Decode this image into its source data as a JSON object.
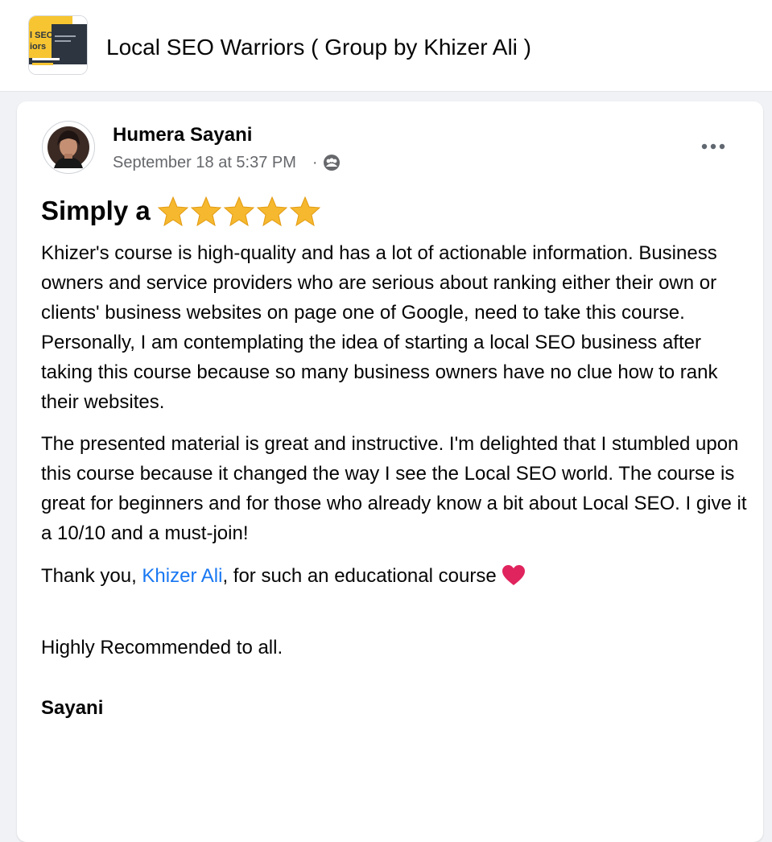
{
  "group": {
    "title": "Local SEO Warriors ( Group by Khizer Ali )",
    "logo_text_line1": "l SEO",
    "logo_text_line2": "iors"
  },
  "post": {
    "author": "Humera Sayani",
    "timestamp": "September 18 at 5:37 PM",
    "meta_separator": "·",
    "audience_icon": "group-audience-icon",
    "more_icon": "more-options-icon",
    "heading": "Simply a",
    "star_count": 5,
    "paragraphs": [
      "Khizer's course is high-quality and has a lot of actionable information. Business owners and service providers who are serious about ranking either their own or clients' business websites on page one of Google, need to take this course. Personally, I am contemplating the idea of starting a local SEO business after taking this course because so many business owners have no clue how to rank their websites.",
      "The presented material is great and instructive. I'm delighted that I stumbled upon this course because it changed the way I see the Local SEO world. The course is great for beginners and for those who already know a bit about Local SEO. I give it a 10/10 and a must-join!"
    ],
    "thanks_prefix": "Thank you, ",
    "mention": "Khizer Ali",
    "thanks_suffix": ", for such an educational course",
    "recommendation": "Highly Recommended to all.",
    "signature": "Sayani"
  },
  "colors": {
    "page_background": "#f0f2f5",
    "card_background": "#ffffff",
    "text_primary": "#050505",
    "text_secondary": "#65676b",
    "mention_link": "#1877f2",
    "star": "#f5b82e",
    "heart": "#e0245e",
    "logo_yellow": "#f7c531",
    "logo_dark": "#2c3540"
  }
}
